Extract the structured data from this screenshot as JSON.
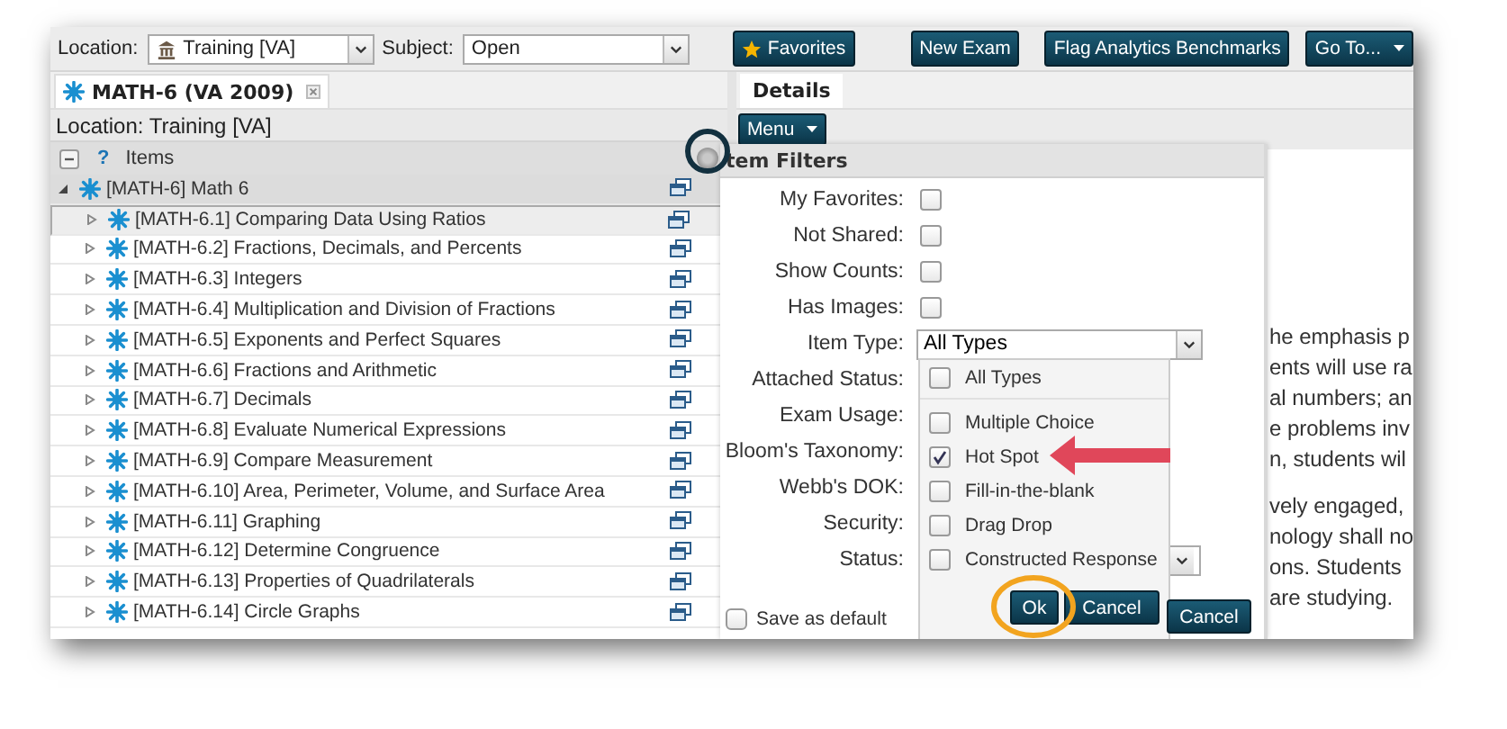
{
  "toolbar": {
    "location_label": "Location:",
    "location": "Training [VA]",
    "subject_label": "Subject:",
    "subject": "Open",
    "buttons": [
      {
        "label": "Favorites",
        "kind": "star"
      },
      {
        "label": "New Exam",
        "kind": "plain"
      },
      {
        "label": "Flag Analytics Benchmarks",
        "kind": "plain"
      },
      {
        "label": "Go To...",
        "kind": "menu"
      }
    ]
  },
  "left_panel": {
    "tab": {
      "label": "MATH-6 (VA 2009)",
      "selected": true
    },
    "location": "Location: Training [VA]",
    "help": "?",
    "items_header": "Items",
    "tree": [
      {
        "label": "[MATH-6] Math 6",
        "expanded": true,
        "selected": false,
        "children": [
          {
            "label": "[MATH-6.1] Comparing Data Using Ratios",
            "expanded": false,
            "selected": true
          },
          {
            "label": "[MATH-6.2] Fractions, Decimals, and Percents",
            "expanded": false,
            "selected": false
          },
          {
            "label": "[MATH-6.3] Integers",
            "expanded": false,
            "selected": false
          },
          {
            "label": "[MATH-6.4] Multiplication and Division of Fractions",
            "expanded": false,
            "selected": false
          },
          {
            "label": "[MATH-6.5] Exponents and Perfect Squares",
            "expanded": false,
            "selected": false
          },
          {
            "label": "[MATH-6.6] Fractions and Arithmetic",
            "expanded": false,
            "selected": false
          },
          {
            "label": "[MATH-6.7] Decimals",
            "expanded": false,
            "selected": false
          },
          {
            "label": "[MATH-6.8] Evaluate Numerical Expressions",
            "expanded": false,
            "selected": false
          },
          {
            "label": "[MATH-6.9] Compare Measurement",
            "expanded": false,
            "selected": false
          },
          {
            "label": "[MATH-6.10] Area, Perimeter, Volume, and Surface Area",
            "expanded": false,
            "selected": false
          },
          {
            "label": "[MATH-6.11] Graphing",
            "expanded": false,
            "selected": false
          },
          {
            "label": "[MATH-6.12] Determine Congruence",
            "expanded": false,
            "selected": false
          },
          {
            "label": "[MATH-6.13] Properties of Quadrilaterals",
            "expanded": false,
            "selected": false
          },
          {
            "label": "[MATH-6.14] Circle Graphs",
            "expanded": false,
            "selected": false
          }
        ]
      }
    ]
  },
  "right_panel": {
    "tabs": [
      {
        "label": "Details",
        "selected": true
      }
    ],
    "menu_button": "Menu",
    "text_paragraphs": [
      [
        "he emphasis p",
        "ents will use ra",
        "al numbers; an",
        "e problems inv",
        "n, students wil"
      ],
      [
        "vely engaged,",
        "nology shall no",
        "ons. Students",
        "are studying."
      ]
    ]
  },
  "item_filters": {
    "title": "tem Filters",
    "fields": [
      {
        "label": "My Favorites:",
        "kind": "checkbox",
        "checked": false
      },
      {
        "label": "Not Shared:",
        "kind": "checkbox",
        "checked": false
      },
      {
        "label": "Show Counts:",
        "kind": "checkbox",
        "checked": false
      },
      {
        "label": "Has Images:",
        "kind": "checkbox",
        "checked": false
      },
      {
        "label": "Item Type:",
        "kind": "select",
        "value": "All Types"
      },
      {
        "label": "Attached Status:",
        "kind": "covered"
      },
      {
        "label": "Exam Usage:",
        "kind": "covered"
      },
      {
        "label": "Bloom's Taxonomy:",
        "kind": "covered"
      },
      {
        "label": "Webb's DOK:",
        "kind": "covered"
      },
      {
        "label": "Security:",
        "kind": "covered"
      },
      {
        "label": "Status:",
        "kind": "select"
      }
    ],
    "type_options": [
      {
        "label": "All Types",
        "kind": "all",
        "checked": false
      },
      {
        "label": "Multiple Choice",
        "kind": "type",
        "checked": false
      },
      {
        "label": "Hot Spot",
        "kind": "type",
        "checked": true
      },
      {
        "label": "Fill-in-the-blank",
        "kind": "type",
        "checked": false
      },
      {
        "label": "Drag Drop",
        "kind": "type",
        "checked": false
      },
      {
        "label": "Constructed Response",
        "kind": "type",
        "checked": false
      }
    ],
    "ok_button": "Ok",
    "cancel_button": "Cancel",
    "cancel_behind": "Cancel",
    "save_default": {
      "label": "Save as default",
      "checked": false
    }
  }
}
